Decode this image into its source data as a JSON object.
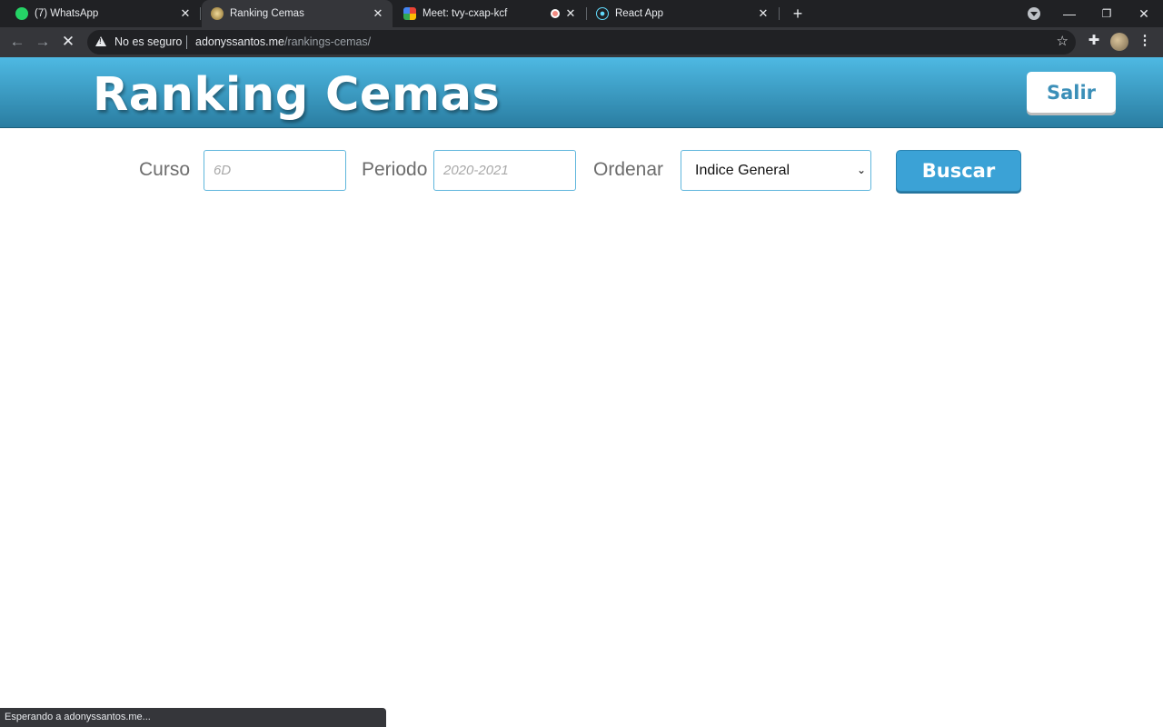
{
  "browser": {
    "tabs": [
      {
        "title": "(7) WhatsApp",
        "icon": "whatsapp-icon",
        "color": "#25d366",
        "active": false
      },
      {
        "title": "Ranking Cemas",
        "icon": "site-favicon",
        "color": "#c8a24a",
        "active": true
      },
      {
        "title": "Meet: tvy-cxap-kcf",
        "icon": "meet-icon",
        "color": "#34a853",
        "active": false
      },
      {
        "title": "React App",
        "icon": "react-icon",
        "color": "#61dafb",
        "active": false
      }
    ],
    "security_label": "No es seguro",
    "url_host": "adonyssantos.me",
    "url_path": "/rankings-cemas/",
    "status_text": "Esperando a adonyssantos.me..."
  },
  "header": {
    "title": "Ranking Cemas",
    "logout_label": "Salir"
  },
  "filters": {
    "curso_label": "Curso",
    "curso_placeholder": "6D",
    "periodo_label": "Periodo",
    "periodo_placeholder": "2020-2021",
    "ordenar_label": "Ordenar",
    "ordenar_selected": "Indice General",
    "search_label": "Buscar"
  },
  "colors": {
    "header_top": "#4eb9e3",
    "header_bottom": "#2a7da1",
    "accent": "#3ba2d6"
  }
}
